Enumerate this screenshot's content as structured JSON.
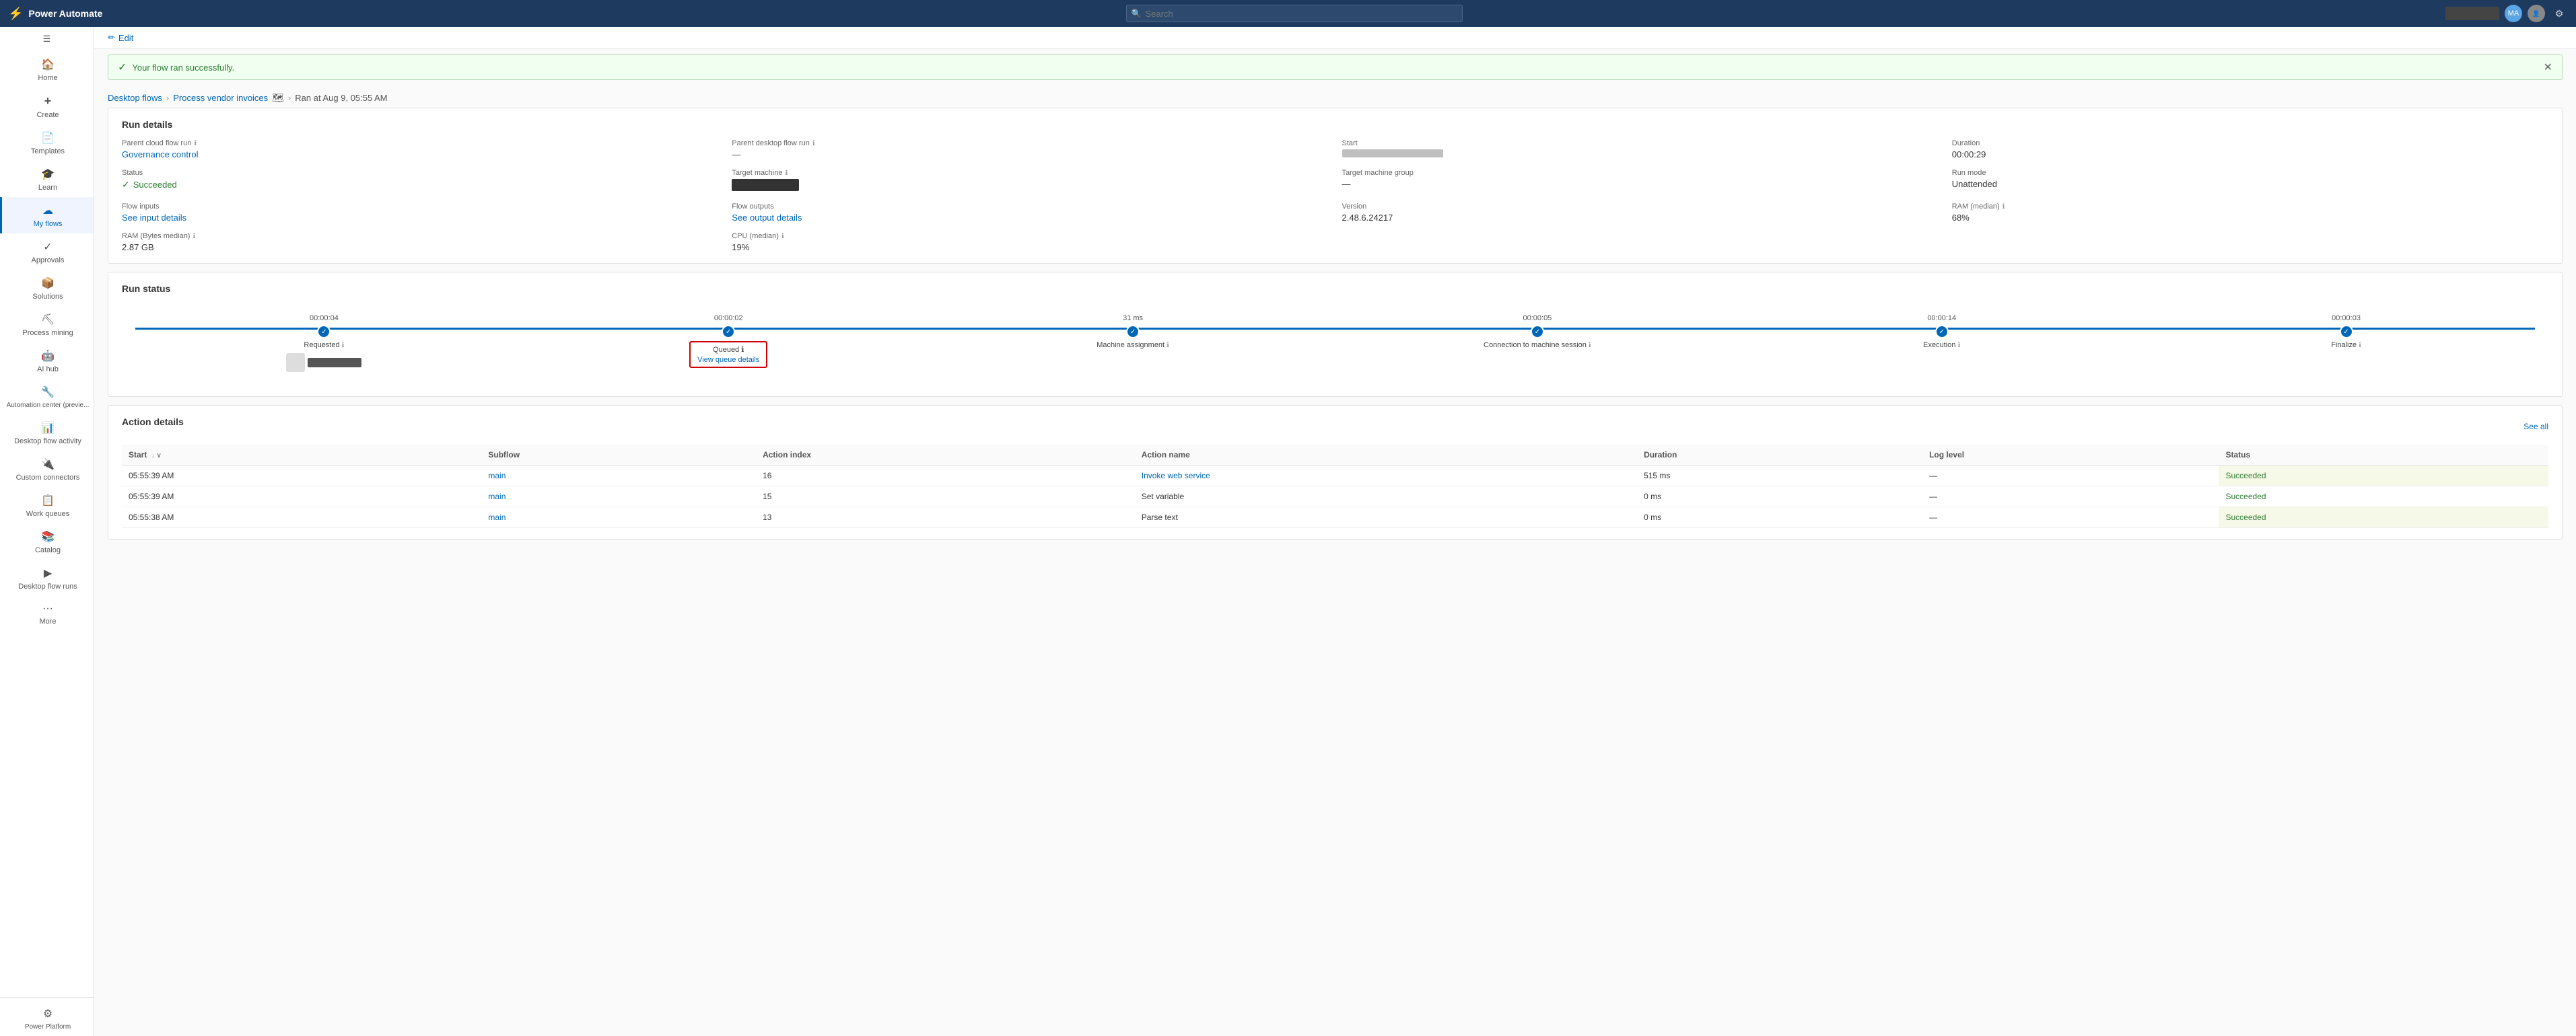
{
  "app": {
    "name": "Power Automate",
    "logo_icon": "⚡"
  },
  "topbar": {
    "search_placeholder": "Search",
    "btn_label": "",
    "avatar_initials": "MA"
  },
  "sidebar": {
    "hamburger_label": "☰",
    "items": [
      {
        "id": "home",
        "icon": "🏠",
        "label": "Home",
        "active": false
      },
      {
        "id": "create",
        "icon": "+",
        "label": "Create",
        "active": false
      },
      {
        "id": "templates",
        "icon": "📄",
        "label": "Templates",
        "active": false
      },
      {
        "id": "learn",
        "icon": "🎓",
        "label": "Learn",
        "active": false
      },
      {
        "id": "my-flows",
        "icon": "☁",
        "label": "My flows",
        "active": true
      },
      {
        "id": "approvals",
        "icon": "✓",
        "label": "Approvals",
        "active": false
      },
      {
        "id": "solutions",
        "icon": "📦",
        "label": "Solutions",
        "active": false
      },
      {
        "id": "process-mining",
        "icon": "⛏",
        "label": "Process mining",
        "active": false
      },
      {
        "id": "ai-hub",
        "icon": "🤖",
        "label": "AI hub",
        "active": false
      },
      {
        "id": "automation-center",
        "icon": "🔧",
        "label": "Automation center (previe...",
        "active": false
      },
      {
        "id": "desktop-flow-activity",
        "icon": "📊",
        "label": "Desktop flow activity",
        "active": false
      },
      {
        "id": "custom-connectors",
        "icon": "🔌",
        "label": "Custom connectors",
        "active": false
      },
      {
        "id": "work-queues",
        "icon": "📋",
        "label": "Work queues",
        "active": false
      },
      {
        "id": "catalog",
        "icon": "📚",
        "label": "Catalog",
        "active": false
      },
      {
        "id": "desktop-flow-runs",
        "icon": "▶",
        "label": "Desktop flow runs",
        "active": false
      },
      {
        "id": "more",
        "icon": "•••",
        "label": "More",
        "active": false
      }
    ],
    "bottom_items": [
      {
        "id": "power-platform",
        "icon": "⚙",
        "label": "Power Platform",
        "active": false
      }
    ]
  },
  "edit_bar": {
    "edit_label": "Edit",
    "edit_icon": "✏"
  },
  "success_banner": {
    "message": "Your flow ran successfully.",
    "icon": "✓"
  },
  "breadcrumb": {
    "desktop_flows": "Desktop flows",
    "flow_name": "Process vendor invoices",
    "map_icon": "🗺",
    "arrow_icon": "▸",
    "run_info": "Ran at Aug 9, 05:55 AM"
  },
  "run_details": {
    "section_title": "Run details",
    "items": [
      {
        "label": "Parent cloud flow run",
        "label_icon": "ℹ",
        "value_type": "link",
        "value": "Governance control"
      },
      {
        "label": "Parent desktop flow run",
        "label_icon": "ℹ",
        "value_type": "text",
        "value": "—"
      },
      {
        "label": "Start",
        "label_icon": "",
        "value_type": "redacted",
        "value": ""
      },
      {
        "label": "Duration",
        "label_icon": "",
        "value_type": "text",
        "value": "00:00:29"
      },
      {
        "label": "Status",
        "label_icon": "",
        "value_type": "status",
        "value": "Succeeded"
      },
      {
        "label": "Target machine",
        "label_icon": "ℹ",
        "value_type": "redacted-dark",
        "value": ""
      },
      {
        "label": "Target machine group",
        "label_icon": "",
        "value_type": "text",
        "value": "—"
      },
      {
        "label": "Run mode",
        "label_icon": "",
        "value_type": "text",
        "value": "Unattended"
      },
      {
        "label": "Flow inputs",
        "label_icon": "",
        "value_type": "link",
        "value": "See input details"
      },
      {
        "label": "Flow outputs",
        "label_icon": "",
        "value_type": "link",
        "value": "See output details"
      },
      {
        "label": "Version",
        "label_icon": "",
        "value_type": "text",
        "value": "2.48.6.24217"
      },
      {
        "label": "RAM (median)",
        "label_icon": "ℹ",
        "value_type": "text",
        "value": "68%"
      },
      {
        "label": "RAM (Bytes median)",
        "label_icon": "ℹ",
        "value_type": "text",
        "value": "2.87 GB"
      },
      {
        "label": "CPU (median)",
        "label_icon": "ℹ",
        "value_type": "text",
        "value": "19%"
      }
    ]
  },
  "run_status": {
    "section_title": "Run status",
    "steps": [
      {
        "id": "requested",
        "name": "Requested",
        "has_info": true,
        "duration": "00:00:04",
        "has_queued_box": false,
        "time_image": true
      },
      {
        "id": "queued",
        "name": "Queued",
        "has_info": true,
        "duration": "00:00:02",
        "has_queued_box": true,
        "queue_link": "View queue details"
      },
      {
        "id": "machine-assignment",
        "name": "Machine assignment",
        "has_info": true,
        "duration": "31 ms",
        "has_queued_box": false
      },
      {
        "id": "connection-to-machine-session",
        "name": "Connection to machine session",
        "has_info": true,
        "duration": "00:00:05",
        "has_queued_box": false
      },
      {
        "id": "execution",
        "name": "Execution",
        "has_info": true,
        "duration": "00:00:14",
        "has_queued_box": false
      },
      {
        "id": "finalize",
        "name": "Finalize",
        "has_info": true,
        "duration": "00:00:03",
        "has_queued_box": false
      }
    ]
  },
  "action_details": {
    "section_title": "Action details",
    "see_all_label": "See all",
    "columns": [
      {
        "id": "start",
        "label": "Start",
        "sortable": true
      },
      {
        "id": "subflow",
        "label": "Subflow",
        "sortable": false
      },
      {
        "id": "action-index",
        "label": "Action index",
        "sortable": false
      },
      {
        "id": "action-name",
        "label": "Action name",
        "sortable": false
      },
      {
        "id": "duration",
        "label": "Duration",
        "sortable": false
      },
      {
        "id": "log-level",
        "label": "Log level",
        "sortable": false
      },
      {
        "id": "status",
        "label": "Status",
        "sortable": false
      }
    ],
    "rows": [
      {
        "start": "05:55:39 AM",
        "subflow": "main",
        "action_index": "16",
        "action_name": "Invoke web service",
        "duration": "515 ms",
        "log_level": "—",
        "status": "Succeeded"
      },
      {
        "start": "05:55:39 AM",
        "subflow": "main",
        "action_index": "15",
        "action_name": "Set variable",
        "duration": "0 ms",
        "log_level": "—",
        "status": "Succeeded"
      },
      {
        "start": "05:55:38 AM",
        "subflow": "main",
        "action_index": "13",
        "action_name": "Parse text",
        "duration": "0 ms",
        "log_level": "—",
        "status": "Succeeded"
      }
    ]
  }
}
